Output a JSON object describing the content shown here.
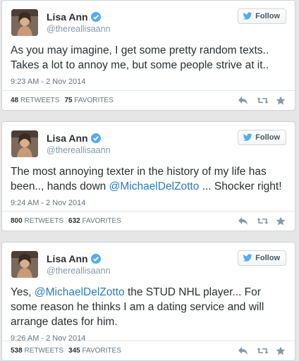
{
  "ui": {
    "follow_label": "Follow",
    "retweets_label": "RETWEETS",
    "favorites_label": "FAVORITES"
  },
  "colors": {
    "mention": "#2b7bb9",
    "verified": "#55acee",
    "background": "#e6e6e6"
  },
  "tweets": [
    {
      "name": "Lisa Ann",
      "handle": "@thereallisaann",
      "text_parts": [
        "As you may imagine, I get some pretty random texts.. Takes a lot to annoy me, but some people strive at it..",
        "",
        ""
      ],
      "time": "9:23 AM - 2 Nov 2014",
      "retweets": "48",
      "favorites": "75"
    },
    {
      "name": "Lisa Ann",
      "handle": "@thereallisaann",
      "text_parts": [
        "The most annoying texter in the history of my life has been.., hands down ",
        "@MichaelDelZotto",
        " ... Shocker right!"
      ],
      "time": "9:24 AM - 2 Nov 2014",
      "retweets": "800",
      "favorites": "632"
    },
    {
      "name": "Lisa Ann",
      "handle": "@thereallisaann",
      "text_parts": [
        "Yes, ",
        "@MichaelDelZotto",
        " the STUD NHL player... For some reason he thinks I am a dating service and will arrange dates for him."
      ],
      "time": "9:26 AM - 2 Nov 2014",
      "retweets": "538",
      "favorites": "345"
    }
  ],
  "icons": [
    "verified-badge-icon",
    "twitter-bird-icon",
    "reply-icon",
    "retweet-icon",
    "favorite-star-icon"
  ]
}
